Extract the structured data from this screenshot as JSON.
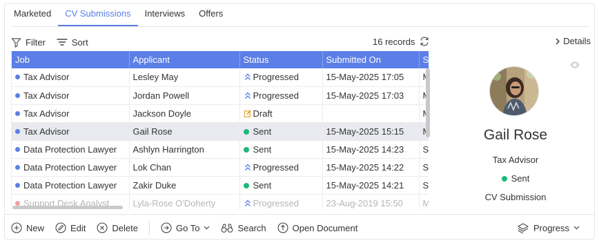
{
  "tabs": [
    {
      "label": "Marketed",
      "active": false
    },
    {
      "label": "CV Submissions",
      "active": true
    },
    {
      "label": "Interviews",
      "active": false
    },
    {
      "label": "Offers",
      "active": false
    }
  ],
  "toolbar": {
    "filter_label": "Filter",
    "sort_label": "Sort",
    "records_label": "16 records",
    "details_label": "Details"
  },
  "grid": {
    "columns": [
      "Job",
      "Applicant",
      "Status",
      "Submitted On",
      "Su"
    ],
    "rows": [
      {
        "job": "Tax Advisor",
        "applicant": "Lesley May",
        "status": "Progressed",
        "status_type": "progressed",
        "submitted": "15-May-2025 17:05",
        "extra": "M",
        "dot": "blue"
      },
      {
        "job": "Tax Advisor",
        "applicant": "Jordan Powell",
        "status": "Progressed",
        "status_type": "progressed",
        "submitted": "15-May-2025 17:03",
        "extra": "M",
        "dot": "blue"
      },
      {
        "job": "Tax Advisor",
        "applicant": "Jackson Doyle",
        "status": "Draft",
        "status_type": "draft",
        "submitted": "",
        "extra": "M",
        "dot": "blue"
      },
      {
        "job": "Tax Advisor",
        "applicant": "Gail Rose",
        "status": "Sent",
        "status_type": "sent",
        "submitted": "15-May-2025 15:15",
        "extra": "M",
        "dot": "blue",
        "selected": true
      },
      {
        "job": "Data Protection Lawyer",
        "applicant": "Ashlyn Harrington",
        "status": "Sent",
        "status_type": "sent",
        "submitted": "15-May-2025 14:23",
        "extra": "S",
        "dot": "blue"
      },
      {
        "job": "Data Protection Lawyer",
        "applicant": "Lok Chan",
        "status": "Progressed",
        "status_type": "progressed",
        "submitted": "15-May-2025 14:22",
        "extra": "S",
        "dot": "blue"
      },
      {
        "job": "Data Protection Lawyer",
        "applicant": "Zakir Duke",
        "status": "Sent",
        "status_type": "sent",
        "submitted": "15-May-2025 14:21",
        "extra": "S",
        "dot": "blue"
      },
      {
        "job": "Support Desk Analyst",
        "applicant": "Lyla-Rose O'Doherty",
        "status": "Progressed",
        "status_type": "progressed",
        "submitted": "23-Aug-2019 15:50",
        "extra": "M",
        "dot": "pink",
        "faded": true
      }
    ]
  },
  "details": {
    "name": "Gail Rose",
    "job": "Tax Advisor",
    "status": "Sent",
    "type": "CV Submission"
  },
  "bottombar": {
    "new_label": "New",
    "edit_label": "Edit",
    "delete_label": "Delete",
    "goto_label": "Go To",
    "search_label": "Search",
    "open_doc_label": "Open Document",
    "progress_label": "Progress"
  },
  "colors": {
    "accent": "#5b7fe6",
    "sent": "#1db87a",
    "draft": "#e0a020"
  }
}
